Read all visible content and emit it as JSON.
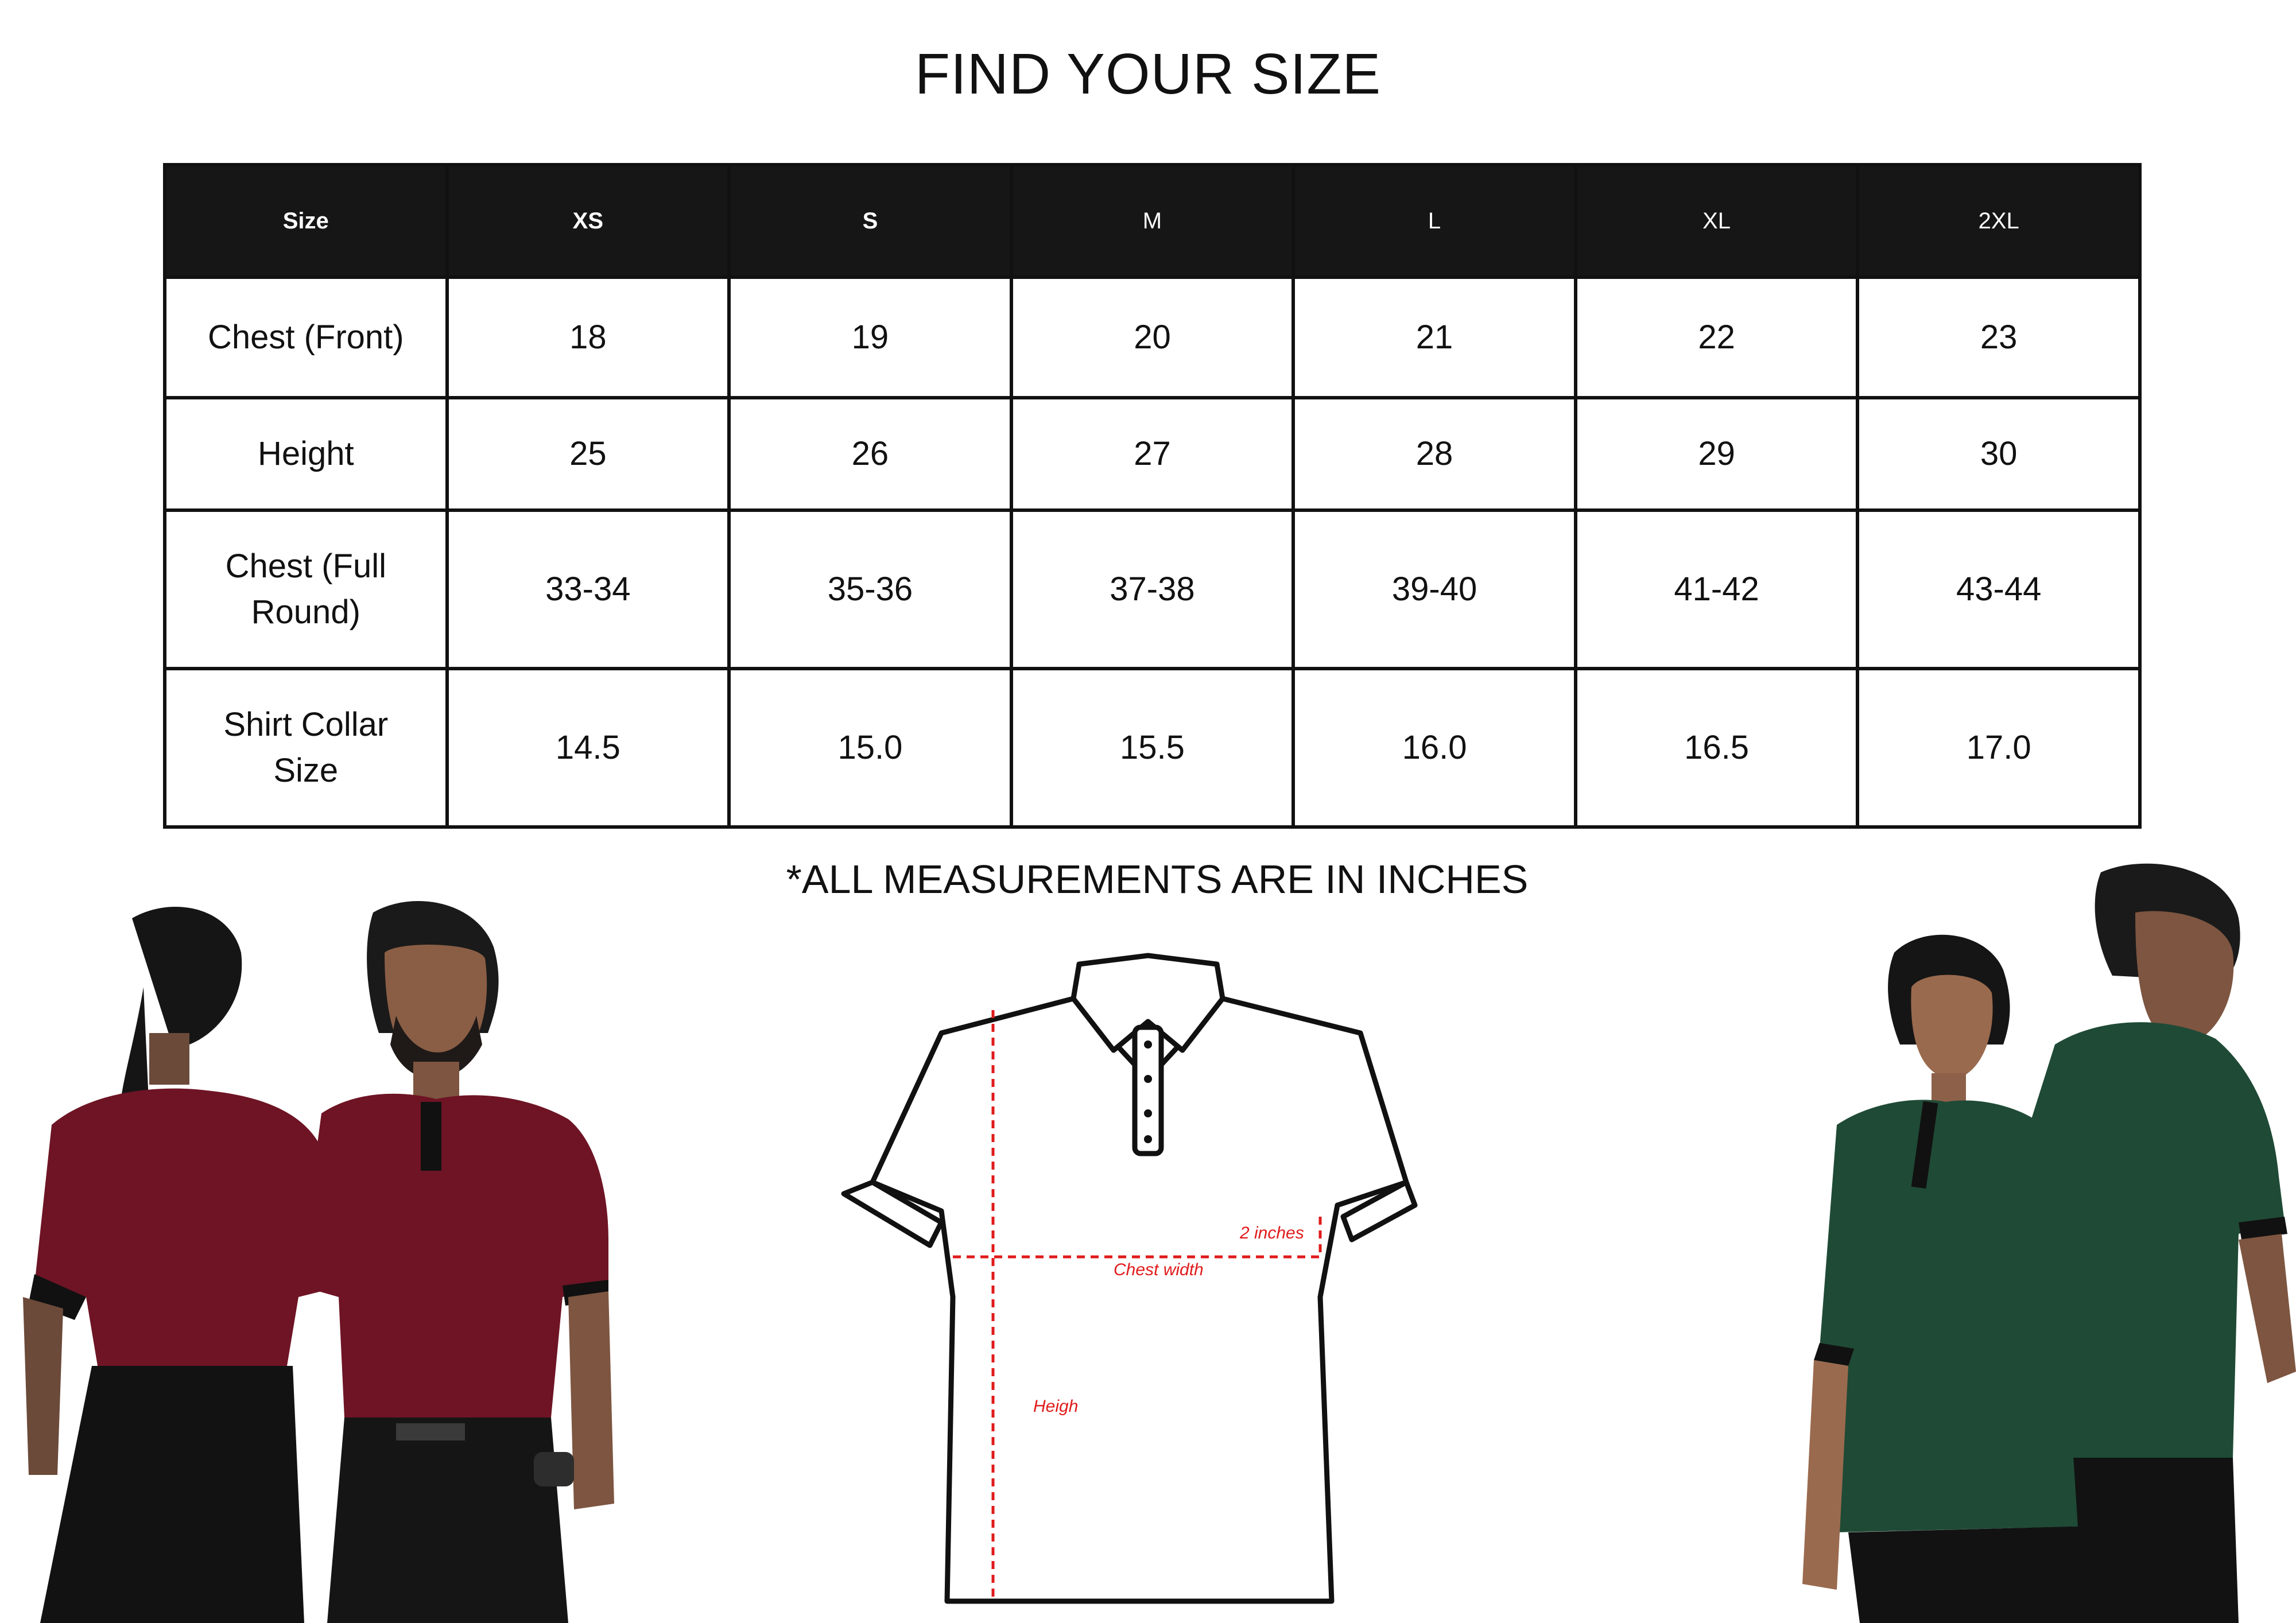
{
  "title": "FIND YOUR SIZE",
  "table": {
    "header": [
      "Size",
      "XS",
      "S",
      "M",
      "L",
      "XL",
      "2XL"
    ],
    "rows": [
      {
        "label": "Chest (Front)",
        "values": [
          "18",
          "19",
          "20",
          "21",
          "22",
          "23"
        ]
      },
      {
        "label": "Height",
        "values": [
          "25",
          "26",
          "27",
          "28",
          "29",
          "30"
        ]
      },
      {
        "label": "Chest (Full Round)",
        "values": [
          "33-34",
          "35-36",
          "37-38",
          "39-40",
          "41-42",
          "43-44"
        ]
      },
      {
        "label": "Shirt Collar Size",
        "values": [
          "14.5",
          "15.0",
          "15.5",
          "16.0",
          "16.5",
          "17.0"
        ]
      }
    ]
  },
  "footnote": "*ALL MEASUREMENTS ARE IN INCHES",
  "diagram": {
    "label_2in": "2 inches",
    "label_chest": "Chest width",
    "label_height": "Heigh",
    "measure_color": "#e01b1b"
  },
  "photos": {
    "left_shirt_color": "#6e1424",
    "right_shirt_color": "#1f4a36"
  }
}
